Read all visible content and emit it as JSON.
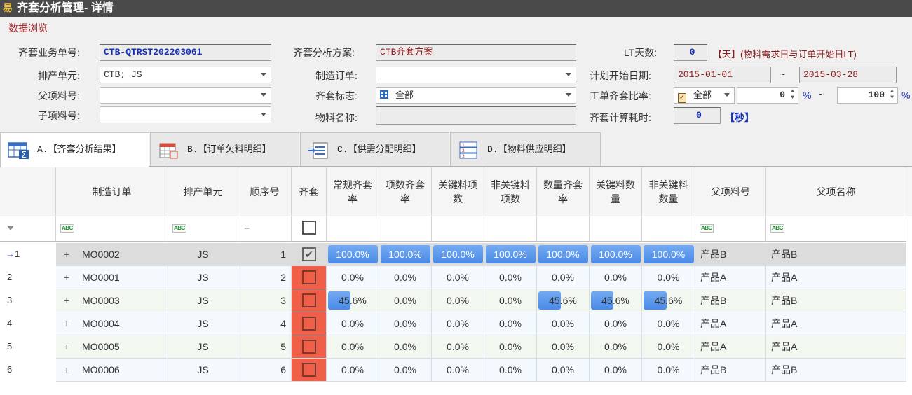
{
  "window": {
    "title": "齐套分析管理- 详情"
  },
  "section": {
    "title": "数据浏览"
  },
  "form": {
    "order_no_label": "齐套业务单号:",
    "order_no": "CTB-QTRST202203061",
    "plan_label": "齐套分析方案:",
    "plan": "CTB齐套方案",
    "lt_label": "LT天数:",
    "lt_value": "0",
    "lt_note": "【天】(物料需求日与订单开始日LT)",
    "unit_label": "排产单元:",
    "unit": "CTB; JS",
    "mo_label": "制造订单:",
    "mo": "",
    "start_label": "计划开始日期:",
    "start_from": "2015-01-01",
    "tilde": "~",
    "start_to": "2015-03-28",
    "parent_label": "父项料号:",
    "parent": "",
    "flag_label": "齐套标志:",
    "flag": "全部",
    "ratio_label": "工单齐套比率:",
    "ratio_sel": "全部",
    "ratio_from": "0",
    "ratio_pct1": "%",
    "ratio_to": "100",
    "ratio_pct2": "%",
    "child_label": "子项料号:",
    "child": "",
    "mat_label": "物料名称:",
    "mat": "",
    "time_label": "齐套计算耗时:",
    "time_value": "0",
    "time_note": "【秒】"
  },
  "tabs": [
    {
      "label": "A.【齐套分析结果】"
    },
    {
      "label": "B.【订单欠料明细】"
    },
    {
      "label": "C.【供需分配明细】"
    },
    {
      "label": "D.【物料供应明细】"
    }
  ],
  "grid": {
    "columns": [
      "制造订单",
      "排产单元",
      "顺序号",
      "齐套",
      "常规齐套率",
      "项数齐套率",
      "关键料项数",
      "非关键料项数",
      "数量齐套率",
      "关键料数量",
      "非关键料数量",
      "父项料号",
      "父项名称"
    ],
    "filter_abc": "ABC",
    "filter_eq": "=",
    "row_indicator": "→",
    "expand": "+",
    "rows": [
      {
        "n": "1",
        "mo": "MO0002",
        "unit": "JS",
        "seq": "1",
        "ok": true,
        "v": [
          "100.0%",
          "100.0%",
          "100.0%",
          "100.0%",
          "100.0%",
          "100.0%",
          "100.0%"
        ],
        "fill": [
          1,
          1,
          1,
          1,
          1,
          1,
          1
        ],
        "pcode": "产品B",
        "pname": "产品B"
      },
      {
        "n": "2",
        "mo": "MO0001",
        "unit": "JS",
        "seq": "2",
        "ok": false,
        "v": [
          "0.0%",
          "0.0%",
          "0.0%",
          "0.0%",
          "0.0%",
          "0.0%",
          "0.0%"
        ],
        "fill": [
          0,
          0,
          0,
          0,
          0,
          0,
          0
        ],
        "pcode": "产品A",
        "pname": "产品A"
      },
      {
        "n": "3",
        "mo": "MO0003",
        "unit": "JS",
        "seq": "3",
        "ok": false,
        "v": [
          "45.6%",
          "0.0%",
          "0.0%",
          "0.0%",
          "45.6%",
          "45.6%",
          "45.6%"
        ],
        "fill": [
          0.456,
          0,
          0,
          0,
          0.456,
          0.456,
          0.456
        ],
        "pcode": "产品B",
        "pname": "产品B"
      },
      {
        "n": "4",
        "mo": "MO0004",
        "unit": "JS",
        "seq": "4",
        "ok": false,
        "v": [
          "0.0%",
          "0.0%",
          "0.0%",
          "0.0%",
          "0.0%",
          "0.0%",
          "0.0%"
        ],
        "fill": [
          0,
          0,
          0,
          0,
          0,
          0,
          0
        ],
        "pcode": "产品A",
        "pname": "产品A"
      },
      {
        "n": "5",
        "mo": "MO0005",
        "unit": "JS",
        "seq": "5",
        "ok": false,
        "v": [
          "0.0%",
          "0.0%",
          "0.0%",
          "0.0%",
          "0.0%",
          "0.0%",
          "0.0%"
        ],
        "fill": [
          0,
          0,
          0,
          0,
          0,
          0,
          0
        ],
        "pcode": "产品A",
        "pname": "产品A"
      },
      {
        "n": "6",
        "mo": "MO0006",
        "unit": "JS",
        "seq": "6",
        "ok": false,
        "v": [
          "0.0%",
          "0.0%",
          "0.0%",
          "0.0%",
          "0.0%",
          "0.0%",
          "0.0%"
        ],
        "fill": [
          0,
          0,
          0,
          0,
          0,
          0,
          0
        ],
        "pcode": "产品B",
        "pname": "产品B"
      }
    ]
  },
  "colors": {
    "bar": "#4a8ae6",
    "fail": "#f06048",
    "selected_row": "#dcdcdc",
    "row_alt1": "#f4f9fd",
    "row_alt2": "#f2f8ef"
  }
}
